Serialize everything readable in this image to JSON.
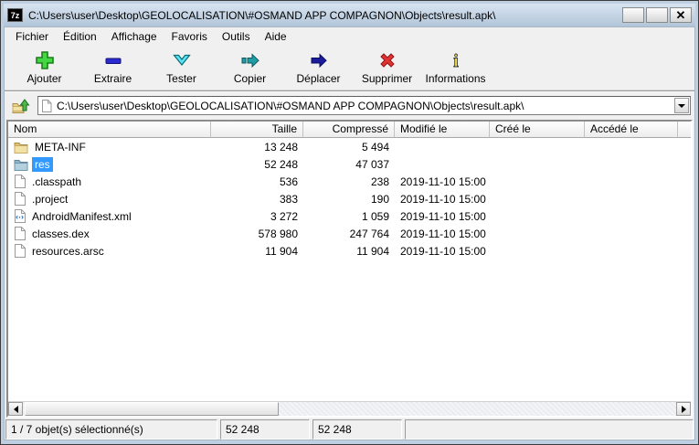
{
  "window": {
    "title": "C:\\Users\\user\\Desktop\\GEOLOCALISATION\\#OSMAND APP COMPAGNON\\Objects\\result.apk\\",
    "app_icon_label": "7z",
    "controls": [
      {
        "name": "minimize-button",
        "glyph": "minimize"
      },
      {
        "name": "maximize-button",
        "glyph": "maximize"
      },
      {
        "name": "close-button",
        "glyph": "close"
      }
    ]
  },
  "menu": {
    "items": [
      "Fichier",
      "Édition",
      "Affichage",
      "Favoris",
      "Outils",
      "Aide"
    ]
  },
  "toolbar": {
    "buttons": [
      {
        "label": "Ajouter",
        "icon": "add-icon"
      },
      {
        "label": "Extraire",
        "icon": "extract-icon"
      },
      {
        "label": "Tester",
        "icon": "test-icon"
      },
      {
        "label": "Copier",
        "icon": "copy-icon"
      },
      {
        "label": "Déplacer",
        "icon": "move-icon"
      },
      {
        "label": "Supprimer",
        "icon": "delete-icon"
      },
      {
        "label": "Informations",
        "icon": "info-icon"
      }
    ]
  },
  "address": {
    "path": "C:\\Users\\user\\Desktop\\GEOLOCALISATION\\#OSMAND APP COMPAGNON\\Objects\\result.apk\\"
  },
  "columns": [
    {
      "label": "Nom",
      "align": "left"
    },
    {
      "label": "Taille",
      "align": "right"
    },
    {
      "label": "Compressé",
      "align": "right"
    },
    {
      "label": "Modifié le",
      "align": "left"
    },
    {
      "label": "Créé le",
      "align": "left"
    },
    {
      "label": "Accédé le",
      "align": "left"
    }
  ],
  "files": [
    {
      "name": "META-INF",
      "icon": "folder-yellow-icon",
      "size": "13 248",
      "packed": "5 494",
      "modified": "",
      "created": "",
      "accessed": "",
      "selected": false
    },
    {
      "name": "res",
      "icon": "folder-blue-icon",
      "size": "52 248",
      "packed": "47 037",
      "modified": "",
      "created": "",
      "accessed": "",
      "selected": true
    },
    {
      "name": ".classpath",
      "icon": "file-icon",
      "size": "536",
      "packed": "238",
      "modified": "2019-11-10 15:00",
      "created": "",
      "accessed": "",
      "selected": false
    },
    {
      "name": ".project",
      "icon": "file-icon",
      "size": "383",
      "packed": "190",
      "modified": "2019-11-10 15:00",
      "created": "",
      "accessed": "",
      "selected": false
    },
    {
      "name": "AndroidManifest.xml",
      "icon": "xml-file-icon",
      "size": "3 272",
      "packed": "1 059",
      "modified": "2019-11-10 15:00",
      "created": "",
      "accessed": "",
      "selected": false
    },
    {
      "name": "classes.dex",
      "icon": "file-icon",
      "size": "578 980",
      "packed": "247 764",
      "modified": "2019-11-10 15:00",
      "created": "",
      "accessed": "",
      "selected": false
    },
    {
      "name": "resources.arsc",
      "icon": "file-icon",
      "size": "11 904",
      "packed": "11 904",
      "modified": "2019-11-10 15:00",
      "created": "",
      "accessed": "",
      "selected": false
    }
  ],
  "status": {
    "panels": [
      "1 / 7 objet(s) sélectionné(s)",
      "52 248",
      "52 248",
      ""
    ]
  },
  "colors": {
    "selection": "#3399ff",
    "titlebar_frame": "#bdcfe1"
  }
}
